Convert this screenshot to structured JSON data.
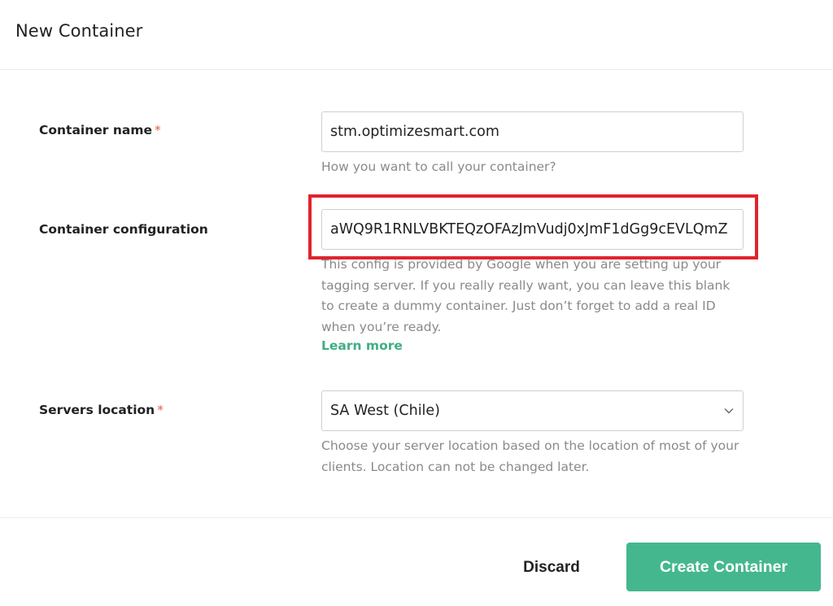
{
  "header": {
    "title": "New Container"
  },
  "form": {
    "container_name": {
      "label": "Container name",
      "required_mark": "*",
      "value": "stm.optimizesmart.com",
      "help": "How you want to call your container?"
    },
    "container_configuration": {
      "label": "Container configuration",
      "value": "aWQ9R1RNLVBKTEQzOFAzJmVudj0xJmF1dGg9cEVLQmZ",
      "help": "This config is provided by Google when you are setting up your tagging server. If you really really want, you can leave this blank to create a dummy container. Just don’t forget to add a real ID when you’re ready.",
      "learn_more": "Learn more"
    },
    "servers_location": {
      "label": "Servers location",
      "required_mark": "*",
      "selected": "SA West (Chile)",
      "help": "Choose your server location based on the location of most of your clients. Location can not be changed later."
    }
  },
  "footer": {
    "discard_label": "Discard",
    "create_label": "Create Container"
  },
  "colors": {
    "primary": "#45b78e",
    "link": "#3fae83",
    "required": "#e05a4f",
    "highlight": "#e0242d",
    "help_text": "#8a8a8a"
  },
  "icons": {
    "select_chevron": "chevron-down-icon"
  }
}
